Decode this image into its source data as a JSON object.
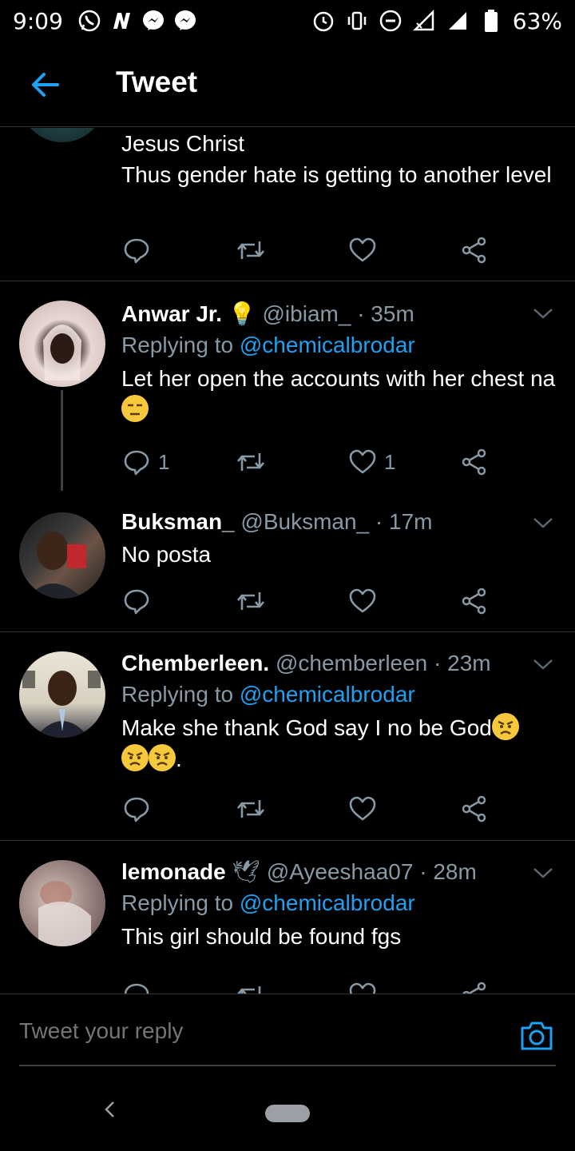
{
  "status_bar": {
    "time": "9:09",
    "battery": "63%",
    "left_icons": [
      "whatsapp-icon",
      "n-icon",
      "messenger-icon",
      "messenger-icon"
    ],
    "right_icons": [
      "alarm-icon",
      "vibrate-icon",
      "dnd-icon",
      "signal-icon",
      "signal-3g-icon",
      "battery-icon"
    ]
  },
  "header": {
    "title": "Tweet",
    "back_icon": "back-arrow-icon"
  },
  "tweets": [
    {
      "id": "t0",
      "text": "Jesus Christ\nThus gender hate is getting to another level",
      "reply_count": "",
      "like_count": ""
    },
    {
      "id": "t1",
      "name": "Anwar Jr.",
      "badge": "💡",
      "handle": "@ibiam_",
      "time": "35m",
      "replying_prefix": "Replying to",
      "replying_handle": "@chemicalbrodar",
      "text": "Let her open the accounts with her chest na",
      "reply_count": "1",
      "like_count": "1"
    },
    {
      "id": "t2",
      "name": "Buksman_",
      "handle": "@Buksman_",
      "time": "17m",
      "text": "No posta",
      "reply_count": "",
      "like_count": ""
    },
    {
      "id": "t3",
      "name": "Chemberleen.",
      "handle": "@chemberleen",
      "time": "23m",
      "replying_prefix": "Replying to",
      "replying_handle": "@chemicalbrodar",
      "text": "Make she thank God say I no be God",
      "text_tail": ".",
      "reply_count": "",
      "like_count": ""
    },
    {
      "id": "t4",
      "name": "lemonade",
      "badge": "🕊",
      "handle": "@Ayeeshaa07",
      "time": "28m",
      "replying_prefix": "Replying to",
      "replying_handle": "@chemicalbrodar",
      "text": "This girl should be found fgs",
      "reply_count": "",
      "like_count": ""
    }
  ],
  "reply_bar": {
    "placeholder": "Tweet your reply",
    "camera_icon": "camera-icon"
  },
  "colors": {
    "background": "#000000",
    "text": "#ffffff",
    "muted": "#8899a6",
    "link": "#1da1f2",
    "divider": "#2f3336"
  }
}
